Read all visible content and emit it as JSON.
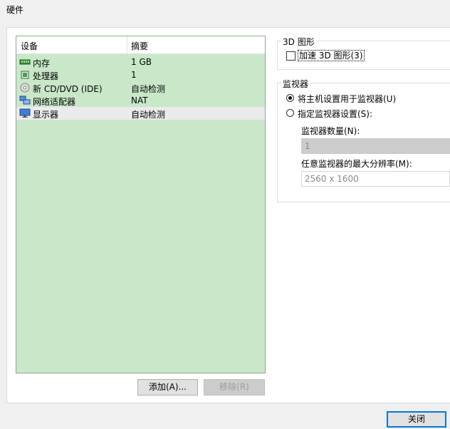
{
  "window": {
    "title": "硬件"
  },
  "device_list": {
    "columns": [
      "设备",
      "摘要"
    ],
    "rows": [
      {
        "name": "内存",
        "summary": "1 GB",
        "icon": "memory-icon"
      },
      {
        "name": "处理器",
        "summary": "1",
        "icon": "processor-icon"
      },
      {
        "name": "新 CD/DVD (IDE)",
        "summary": "自动检测",
        "icon": "cd-dvd-icon"
      },
      {
        "name": "网络适配器",
        "summary": "NAT",
        "icon": "network-adapter-icon"
      },
      {
        "name": "显示器",
        "summary": "自动检测",
        "icon": "display-icon",
        "selected": true
      }
    ]
  },
  "buttons": {
    "add": "添加(A)...",
    "remove": "移除(R)",
    "close": "关闭"
  },
  "graphics_3d": {
    "title": "3D 图形",
    "accelerate_label": "加速 3D 图形(3)",
    "accelerate_checked": false
  },
  "monitors": {
    "title": "监视器",
    "option_host_label": "将主机设置用于监视器(U)",
    "option_specify_label": "指定监视器设置(S):",
    "selected_option": "host",
    "count_label": "监视器数量(N):",
    "count_value": "1",
    "max_res_label": "任意监视器的最大分辨率(M):",
    "max_res_value": "2560 x 1600"
  },
  "colors": {
    "list_background": "#c9e8c9",
    "selected_row": "#ebebeb",
    "primary_button_border": "#0078d7"
  }
}
